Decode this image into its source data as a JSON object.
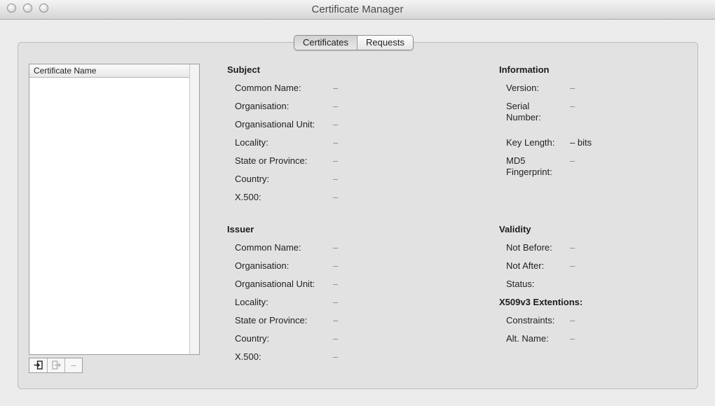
{
  "window": {
    "title": "Certificate Manager"
  },
  "tabs": [
    {
      "label": "Certificates",
      "active": true
    },
    {
      "label": "Requests",
      "active": false
    }
  ],
  "list": {
    "column_header": "Certificate Name",
    "items": []
  },
  "toolbar": {
    "import_icon": "import-icon",
    "export_icon": "export-icon",
    "remove_label": "–"
  },
  "subject": {
    "title": "Subject",
    "fields": [
      {
        "label": "Common Name:",
        "value": "–"
      },
      {
        "label": "Organisation:",
        "value": "–"
      },
      {
        "label": "Organisational Unit:",
        "value": "–"
      },
      {
        "label": "Locality:",
        "value": "–"
      },
      {
        "label": "State or Province:",
        "value": "–"
      },
      {
        "label": "Country:",
        "value": "–"
      },
      {
        "label": "X.500:",
        "value": "–"
      }
    ]
  },
  "issuer": {
    "title": "Issuer",
    "fields": [
      {
        "label": "Common Name:",
        "value": "–"
      },
      {
        "label": "Organisation:",
        "value": "–"
      },
      {
        "label": "Organisational Unit:",
        "value": "–"
      },
      {
        "label": "Locality:",
        "value": "–"
      },
      {
        "label": "State or Province:",
        "value": "–"
      },
      {
        "label": "Country:",
        "value": "–"
      },
      {
        "label": "X.500:",
        "value": "–"
      }
    ]
  },
  "information": {
    "title": "Information",
    "version_label": "Version:",
    "version_value": "–",
    "serial_label_1": "Serial",
    "serial_label_2": "Number:",
    "serial_value": "–",
    "keylength_label": "Key Length:",
    "keylength_value": "– bits",
    "md5_label_1": "MD5",
    "md5_label_2": "Fingerprint:",
    "md5_value": "–"
  },
  "validity": {
    "title": "Validity",
    "not_before_label": "Not Before:",
    "not_before_value": "–",
    "not_after_label": "Not After:",
    "not_after_value": "–",
    "status_label": "Status:"
  },
  "x509": {
    "title": "X509v3 Extentions:",
    "constraints_label": "Constraints:",
    "constraints_value": "–",
    "altname_label": "Alt. Name:",
    "altname_value": "–"
  }
}
